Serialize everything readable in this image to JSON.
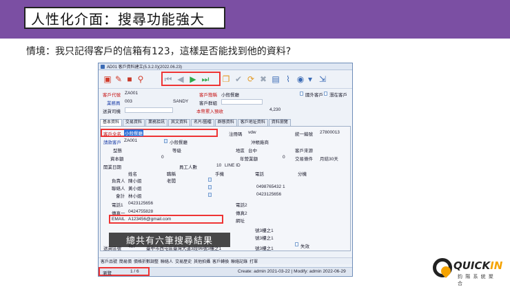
{
  "slide": {
    "title": "人性化介面：搜尋功能強大",
    "question": "情境：我只記得客戶的信箱有123，這樣是否能找到他的資料?",
    "overlay": "總共有六筆搜尋結果"
  },
  "window": {
    "title": "AD01 客戶資料建立(5.3.2.0)(2022.06.23)",
    "toolbar": [
      {
        "name": "add-icon",
        "glyph": "▣",
        "color": "#d23b2a"
      },
      {
        "name": "edit-icon",
        "glyph": "✎",
        "color": "#d23b2a"
      },
      {
        "name": "delete-icon",
        "glyph": "■",
        "color": "#c73a2a"
      },
      {
        "name": "search-icon",
        "glyph": "⚲",
        "color": "#d23b2a"
      },
      {
        "name": "first-record-icon",
        "glyph": "⏮",
        "color": "#9aa6b6"
      },
      {
        "name": "prev-record-icon",
        "glyph": "◀",
        "color": "#9aa6b6"
      },
      {
        "name": "next-record-icon",
        "glyph": "▶",
        "color": "#2ea84a"
      },
      {
        "name": "last-record-icon",
        "glyph": "⏭",
        "color": "#2ea84a"
      },
      {
        "name": "copy-icon",
        "glyph": "❐",
        "color": "#e39a26"
      },
      {
        "name": "confirm-icon",
        "glyph": "✔",
        "color": "#9aa6b6"
      },
      {
        "name": "refresh-icon",
        "glyph": "⟳",
        "color": "#e39a26"
      },
      {
        "name": "cancel-icon",
        "glyph": "✖",
        "color": "#9aa6b6"
      },
      {
        "name": "list-icon",
        "glyph": "▤",
        "color": "#3b6bb5"
      },
      {
        "name": "attach-icon",
        "glyph": "⌇",
        "color": "#3b6bb5"
      },
      {
        "name": "view-icon",
        "glyph": "◉",
        "color": "#3b6bb5"
      },
      {
        "name": "dropdown-icon",
        "glyph": "▾",
        "color": "#3b6bb5"
      },
      {
        "name": "exit-icon",
        "glyph": "⇲",
        "color": "#3b6bb5"
      }
    ],
    "header": {
      "customer_code_label": "客戶代號",
      "customer_code": "ZA001",
      "customer_short_label": "客戶簡稱",
      "customer_short": "小殼餐廳",
      "overseas_label": "國外客戶",
      "potential_label": "潛在客戶",
      "sales_label": "業務員",
      "sales_code": "003",
      "sales_name": "SANDY",
      "group_label": "客戶群組",
      "shipping_label": "送貨司機",
      "receivable_label": "本幣累入預收",
      "receivable": "4,230"
    },
    "tabs": [
      "基本資料",
      "交易資料",
      "業務拾訊",
      "其文資料",
      "名片/圖檔",
      "群態資料",
      "客戶地址資料",
      "資料瀏覽"
    ],
    "basic": {
      "full_name_label": "客戶全名",
      "full_name": "小殼餐廳",
      "reg_no_label": "注冊碼",
      "reg_no": "vdw",
      "tax_id_label": "統一編號",
      "tax_id": "27800013",
      "billing_label": "請款客戶",
      "billing_code": "ZA001",
      "billing_name": "小殼餐廳",
      "dept_label": "沖帳廠商",
      "type_label": "型態",
      "grade_label": "等級",
      "region_label": "地區",
      "region": "台中",
      "source_label": "客戶來源",
      "capital_label": "資本額",
      "capital": "0",
      "revenue_label": "年營業額",
      "revenue": "0",
      "terms_label": "交易條件",
      "terms": "月結30天",
      "open_date_label": "開業日期",
      "staff_label": "員工人數",
      "staff": "10",
      "line_label": "LINE ID"
    },
    "contacts": {
      "headers": [
        "姓名",
        "職稱",
        "手機",
        "電話",
        "分機"
      ],
      "rows": [
        {
          "role": "負責人",
          "name": "陳小姐",
          "title": "老闆",
          "phone": ""
        },
        {
          "role": "聯絡人",
          "name": "黃小姐",
          "title": "",
          "phone": "0498765432 1"
        },
        {
          "role": "會計",
          "name": "林小姐",
          "title": "",
          "phone": "0423125656"
        }
      ]
    },
    "comm": {
      "phone1_label": "電話1",
      "phone1": "0423125656",
      "phone2_label": "電話2",
      "fax1_label": "傳真一",
      "fax1": "0424755828",
      "fax2_label": "傳真2",
      "email_label": "EMAIL",
      "email": "A123456@gmail.com",
      "url_label": "網址",
      "addr_label": "送貨區號",
      "addr_code": "407",
      "addr": "臺中市西屯區臺灣大道3段96號3樓之1",
      "other_addr1": "號3樓之1",
      "other_addr2": "號3樓之1",
      "other_addr3": "號3樓之1",
      "invalid_label": "失效"
    },
    "bottom_tabs": [
      "客戶品號",
      "簡易價",
      "價格折數調整",
      "聯絡人",
      "交易歷史",
      "其他拍攝",
      "客戶轉換",
      "聯絡記錄",
      "打單"
    ],
    "status": {
      "browse_label": "瀏覽",
      "record": "1 / 6",
      "meta": "Create: admin 2021-03-22 | Modify: admin 2022-06-29"
    }
  },
  "logo": {
    "brand_a": "QUICK",
    "brand_b": "IN",
    "sub": "鈞 陽 系 統 聚 合"
  },
  "colors": {
    "purple_bar": "#7b4fa3",
    "highlight": "#ee3333",
    "accent": "#f5a300"
  }
}
